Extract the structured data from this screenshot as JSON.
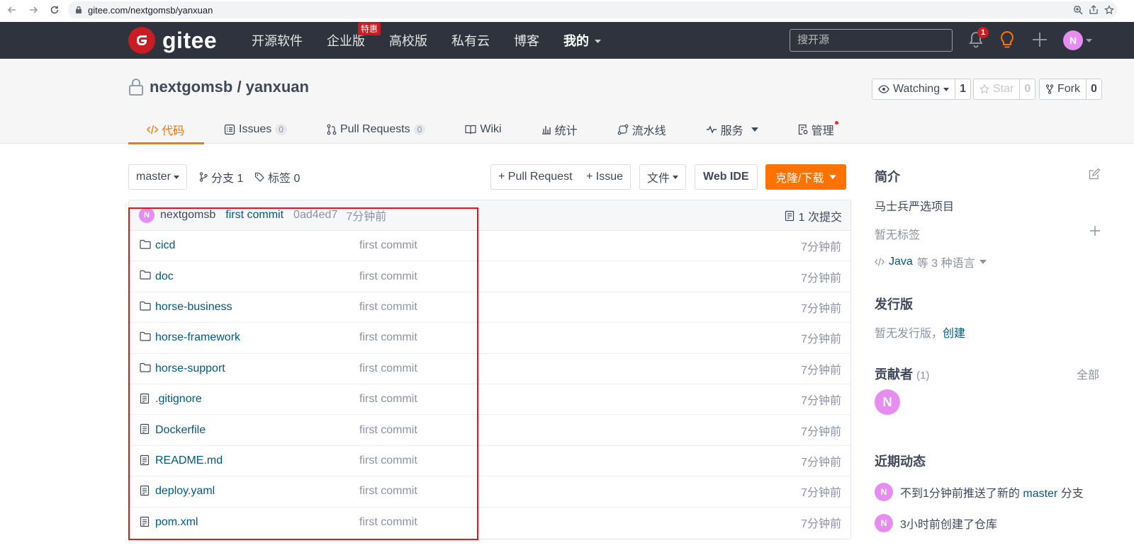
{
  "browser": {
    "url": "gitee.com/nextgomsb/yanxuan"
  },
  "header": {
    "logo_text": "gitee",
    "nav": [
      "开源软件",
      "企业版",
      "高校版",
      "私有云",
      "博客",
      "我的"
    ],
    "hot_badge": "特惠",
    "search_placeholder": "搜开源",
    "notification_count": "1",
    "avatar_letter": "N"
  },
  "repo": {
    "title": "nextgomsb / yanxuan",
    "watch_label": "Watching",
    "watch_count": "1",
    "star_label": "Star",
    "star_count": "0",
    "fork_label": "Fork",
    "fork_count": "0",
    "tabs": [
      {
        "label": "代码"
      },
      {
        "label": "Issues",
        "count": "0"
      },
      {
        "label": "Pull Requests",
        "count": "0"
      },
      {
        "label": "Wiki"
      },
      {
        "label": "统计"
      },
      {
        "label": "流水线"
      },
      {
        "label": "服务"
      },
      {
        "label": "管理"
      }
    ]
  },
  "toolbar": {
    "branch": "master",
    "branches": "分支 1",
    "tags": "标签 0",
    "pull_request": "+ Pull Request",
    "issue": "+ Issue",
    "file": "文件",
    "web_ide": "Web IDE",
    "clone": "克隆/下载"
  },
  "commit": {
    "avatar_letter": "N",
    "author": "nextgomsb",
    "message": "first commit",
    "sha": "0ad4ed7",
    "time": "7分钟前",
    "commits": "1 次提交"
  },
  "files": [
    {
      "name": "cicd",
      "type": "folder",
      "message": "first commit",
      "time": "7分钟前"
    },
    {
      "name": "doc",
      "type": "folder",
      "message": "first commit",
      "time": "7分钟前"
    },
    {
      "name": "horse-business",
      "type": "folder",
      "message": "first commit",
      "time": "7分钟前"
    },
    {
      "name": "horse-framework",
      "type": "folder",
      "message": "first commit",
      "time": "7分钟前"
    },
    {
      "name": "horse-support",
      "type": "folder",
      "message": "first commit",
      "time": "7分钟前"
    },
    {
      "name": ".gitignore",
      "type": "file",
      "message": "first commit",
      "time": "7分钟前"
    },
    {
      "name": "Dockerfile",
      "type": "file",
      "message": "first commit",
      "time": "7分钟前"
    },
    {
      "name": "README.md",
      "type": "file",
      "message": "first commit",
      "time": "7分钟前"
    },
    {
      "name": "deploy.yaml",
      "type": "file",
      "message": "first commit",
      "time": "7分钟前"
    },
    {
      "name": "pom.xml",
      "type": "file",
      "message": "first commit",
      "time": "7分钟前"
    }
  ],
  "sidebar": {
    "intro_title": "简介",
    "intro_text": "马士兵严选项目",
    "no_tags": "暂无标签",
    "lang_main": "Java",
    "lang_rest": "等 3 种语言",
    "release_title": "发行版",
    "no_release": "暂无发行版，",
    "create": "创建",
    "contributors_title": "贡献者",
    "contributors_count": "(1)",
    "all": "全部",
    "contributor_letter": "N",
    "activity_title": "近期动态",
    "activity": [
      {
        "pre": "不到1分钟前推送了新的 ",
        "link": "master",
        "post": " 分支"
      },
      {
        "pre": "3小时前创建了仓库",
        "link": "",
        "post": ""
      }
    ]
  },
  "colors": {
    "accent": "#fe7300",
    "header_bg": "#2f333d",
    "brand_red": "#c71d23",
    "link": "#005980",
    "highlight_box": "#e8141b"
  }
}
